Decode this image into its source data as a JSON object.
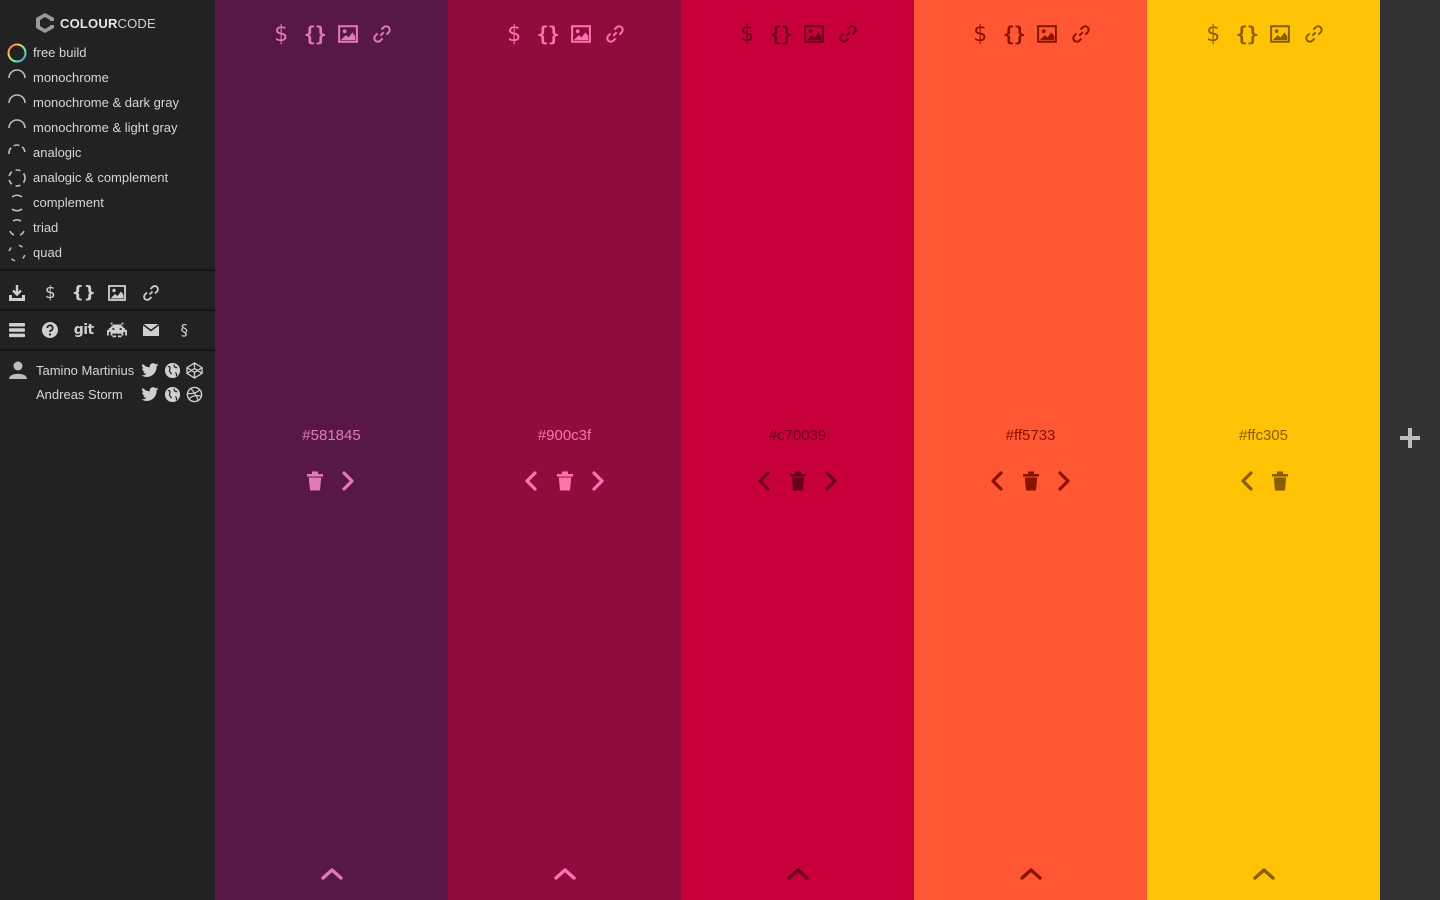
{
  "brand": {
    "name_bold": "COLOUR",
    "name_thin": "CODE"
  },
  "modes": [
    {
      "label": "free build",
      "icon": "color-wheel-icon"
    },
    {
      "label": "monochrome",
      "icon": "arc-one-icon"
    },
    {
      "label": "monochrome & dark gray",
      "icon": "arc-one-icon"
    },
    {
      "label": "monochrome & light gray",
      "icon": "arc-one-icon"
    },
    {
      "label": "analogic",
      "icon": "arc-three-icon"
    },
    {
      "label": "analogic & complement",
      "icon": "arc-four-icon"
    },
    {
      "label": "complement",
      "icon": "arc-two-icon"
    },
    {
      "label": "triad",
      "icon": "arc-three-split-icon"
    },
    {
      "label": "quad",
      "icon": "arc-quad-icon"
    }
  ],
  "export_row": {
    "download_icon": "download-icon",
    "sass_glyph": "$",
    "css_glyph": "{}",
    "image_icon": "image-icon",
    "link_icon": "link-icon"
  },
  "meta_row": {
    "menu_icon": "menu-icon",
    "help_icon": "help-icon",
    "git_label": "git",
    "bug_icon": "space-invader-icon",
    "mail_icon": "mail-icon",
    "section_glyph": "§"
  },
  "credits": [
    {
      "name": "Tamino Martinius"
    },
    {
      "name": "Andreas Storm"
    }
  ],
  "palette": [
    {
      "hex": "#581845",
      "bg": "#581845",
      "fg": "#e07ab8",
      "has_left": false,
      "has_right": true
    },
    {
      "hex": "#900c3f",
      "bg": "#900c3f",
      "fg": "#ff72aa",
      "has_left": true,
      "has_right": true
    },
    {
      "hex": "#c70039",
      "bg": "#c70039",
      "fg": "#6a0020",
      "has_left": true,
      "has_right": true
    },
    {
      "hex": "#ff5733",
      "bg": "#ff5733",
      "fg": "#8a1200",
      "has_left": true,
      "has_right": true
    },
    {
      "hex": "#ffc305",
      "bg": "#ffc305",
      "fg": "#8a5d00",
      "has_left": true,
      "has_right": false
    }
  ],
  "column_tools": {
    "sass_glyph": "$",
    "css_glyph": "{}"
  },
  "colors": {
    "sidebar_bg": "#222222",
    "add_strip_bg": "#333333",
    "add_icon": "#bdbdbd"
  }
}
